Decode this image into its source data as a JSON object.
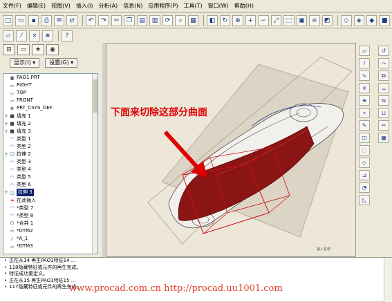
{
  "menu": [
    "文件(F)",
    "编辑(E)",
    "视图(V)",
    "插入(I)",
    "分析(A)",
    "信息(N)",
    "应用程序(P)",
    "工具(T)",
    "窗口(W)",
    "帮助(H)"
  ],
  "panel": {
    "show_label": "显示(I) ▾",
    "settings_label": "设置(G) ▾"
  },
  "tree": [
    {
      "label": "PAO1.PRT",
      "icon": "part-icon",
      "exp": ""
    },
    {
      "label": "RIGHT",
      "icon": "datum-plane-icon",
      "exp": ""
    },
    {
      "label": "TOP",
      "icon": "datum-plane-icon",
      "exp": ""
    },
    {
      "label": "FRONT",
      "icon": "datum-plane-icon",
      "exp": ""
    },
    {
      "label": "PRT_CSYS_DEF",
      "icon": "csys-icon",
      "exp": ""
    },
    {
      "label": "填充 1",
      "icon": "fill-icon",
      "exp": "+"
    },
    {
      "label": "填充 2",
      "icon": "fill-icon",
      "exp": "+"
    },
    {
      "label": "填充 3",
      "icon": "fill-icon",
      "exp": "+"
    },
    {
      "label": "类型 1",
      "icon": "surface-icon",
      "exp": ""
    },
    {
      "label": "类型 2",
      "icon": "surface-icon",
      "exp": ""
    },
    {
      "label": "拉伸 2",
      "icon": "extrude-icon",
      "exp": "+"
    },
    {
      "label": "类型 3",
      "icon": "surface-icon",
      "exp": ""
    },
    {
      "label": "类型 4",
      "icon": "surface-icon",
      "exp": ""
    },
    {
      "label": "类型 5",
      "icon": "surface-icon",
      "exp": ""
    },
    {
      "label": "类型 6",
      "icon": "surface-icon",
      "exp": ""
    },
    {
      "label": "拉伸 3",
      "icon": "extrude-icon",
      "exp": "+"
    },
    {
      "label": "在此插入",
      "icon": "insert-here-icon",
      "exp": ""
    },
    {
      "label": "*类型 7",
      "icon": "surface-icon",
      "exp": ""
    },
    {
      "label": "*类型 8",
      "icon": "surface-icon",
      "exp": ""
    },
    {
      "label": "*合并 1",
      "icon": "merge-icon",
      "exp": ""
    },
    {
      "label": "*DTM2",
      "icon": "datum-plane-icon",
      "exp": ""
    },
    {
      "label": "*A_1",
      "icon": "axis-icon",
      "exp": ""
    },
    {
      "label": "*DTM3",
      "icon": "datum-plane-icon",
      "exp": ""
    }
  ],
  "selected_tree_index": 15,
  "callout_text": "下面来切除这部分曲面",
  "messages": [
    "正在从14 再生PAO1特征14 ...",
    "118隐藏特征或元件的再生完成。",
    "特征成功重定义。",
    "正在从15 再生PAO1特征15 ...",
    "117隐藏特征或元件的再生完成。"
  ],
  "watermark": "www.procad.com.cn    http://procad.uu1001.com",
  "viewport_label": "输入名称",
  "colors": {
    "accent": "#e00000",
    "surface": "#8b1414",
    "selection": "#0a246a"
  }
}
